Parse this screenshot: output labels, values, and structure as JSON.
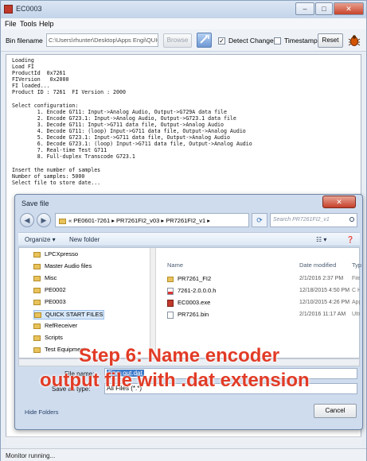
{
  "window": {
    "title": "EC0003",
    "controls": {
      "minimize": "–",
      "maximize": "□",
      "close": "✕"
    }
  },
  "menubar": {
    "items": [
      "File",
      "Tools",
      "Help"
    ]
  },
  "toolbar": {
    "bin_filename_label": "Bin filename",
    "bin_filename_value": "C:\\Users\\rhunter\\Desktop\\Apps Engi\\QUIC",
    "browse_label": "Browse",
    "detect_changes_label": "Detect Changes",
    "detect_changes_checked": true,
    "timestamp_label": "Timestamp",
    "timestamp_checked": false,
    "reset_label": "Reset"
  },
  "console": {
    "lines": [
      "Loading",
      "Load FI",
      "ProductId  0x7261",
      "FIVersion   0x2000",
      "FI loaded...",
      "Product ID : 7261  FI Version : 2000",
      "",
      "Select configuration:",
      "        1. Encode G711: Input->Analog Audio, Output->G729A data file",
      "        2. Encode G723.1: Input->Analog Audio, Output->G723.1 data file",
      "        3. Decode G711: Input->G711 data file, Output->Analog Audio",
      "        4. Decode G711: (loop) Input->G711 data file, Output->Analog Audio",
      "        5. Decode G723.1: Input->G711 data file, Output->Analog Audio",
      "        6. Decode G723.1: (loop) Input->G711 data file, Output->Analog Audio",
      "        7. Real-time Test G711",
      "        8. Full-duplex Transcode G723.1",
      "",
      "Insert the number of samples",
      "Number of samples: 5000",
      "Select file to store date..."
    ]
  },
  "status": {
    "text": "Monitor running..."
  },
  "save_dialog": {
    "title": "Save file",
    "close_label": "✕",
    "address": "« PE0601-7261 ▸ PR7261FI2_v03 ▸ PR7261FI2_v1 ▸",
    "search_placeholder": "Search PR7261FI2_v1",
    "organize_label": "Organize ▾",
    "new_folder_label": "New folder",
    "tree": [
      "LPCXpresso",
      "Master Audio files",
      "Misc",
      "PE0002",
      "PE0003",
      "QUICK START FILES",
      "RefReceiver",
      "Scripts",
      "Test Equipment"
    ],
    "tree_selected": "QUICK START FILES",
    "columns": {
      "name": "Name",
      "date": "Date modified",
      "type": "Typ"
    },
    "files": [
      {
        "name": "PR7261_FI2",
        "icon": "folder-icon",
        "date": "2/1/2016 2:37 PM",
        "type": "File"
      },
      {
        "name": "7261-2.0.0.0.h",
        "icon": "h-file-icon",
        "date": "12/18/2015 4:50 PM",
        "type": "C H"
      },
      {
        "name": "EC0003.exe",
        "icon": "exe-file-icon",
        "date": "12/10/2015 4:26 PM",
        "type": "App"
      },
      {
        "name": "PR7261.bin",
        "icon": "bin-file-icon",
        "date": "2/1/2016 11:17 AM",
        "type": "Ultr"
      }
    ],
    "file_name_label": "File name:",
    "file_name_value": "Enc_out.dat",
    "save_as_type_label": "Save as type:",
    "save_as_type_value": "All Files (*.*)",
    "hide_folders_label": "Hide Folders",
    "cancel_label": "Cancel"
  },
  "annotation": {
    "line1": "Step 6: Name encoder",
    "line2": "output file with .dat extension",
    "color": "#e23b26"
  }
}
